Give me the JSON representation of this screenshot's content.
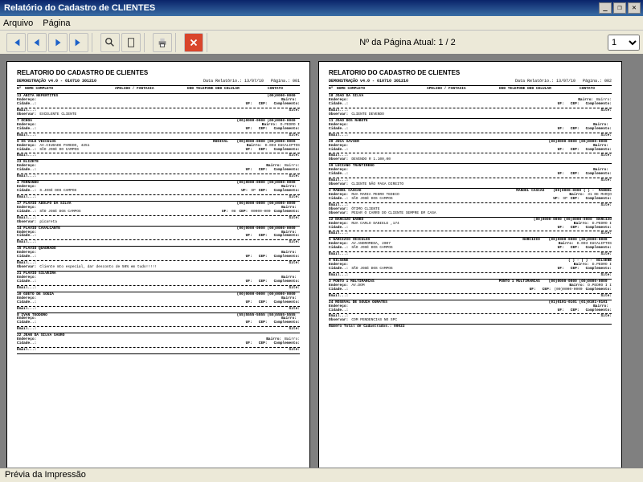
{
  "window": {
    "title": "Relatório do Cadastro de CLIENTES"
  },
  "menu": {
    "file": "Arquivo",
    "page": "Página"
  },
  "toolbar": {
    "page_label": "Nº da Página Atual: 1 / 2",
    "page_select": "1"
  },
  "statusbar": "Prévia da Impressão",
  "report": {
    "title": "RELATORIO DO CADASTRO DE CLIENTES",
    "company": "DEMONSTRAÇÃO v4.0 - 010710 301210",
    "date_label": "Data Relatório.:",
    "date": "13/07/10",
    "page_label": "Página.:",
    "colhead": {
      "num": "Nº",
      "name": "NOME COMPLETO",
      "fantasy": "APELIDO / FANTASIA",
      "phone": "DDD TELEFONE DDD CELULAR",
      "contact": "CONTATO"
    },
    "labels": {
      "endereco": "Endereço:",
      "bairro": "Bairro:",
      "cidade": "Cidade..:",
      "uf": "UF:",
      "cep": "CEP:",
      "complemento": "Complemento:",
      "email": "Email...:",
      "site": "Site:",
      "observar": "Observar:",
      "total": "Número Total de Cadastrados.:"
    },
    "pages": [
      {
        "page_no": "001",
        "records": [
          {
            "id": "13",
            "name": "ANITA NEFERTITES",
            "phone": "(00)0000-0000",
            "obs": "EXCELENTE CLIENTE"
          },
          {
            "id": "7",
            "name": "OCHOA",
            "phone": "(00)0000-0000 (00)0000-0000",
            "bairro": "D.PEDRO I"
          },
          {
            "id": "6",
            "name": "OS VALE VEICULOS",
            "fantasy": "RUDIVAL",
            "phone": "(00)0000-0000 (00)0000-0000",
            "endereco": "AV.CIUDADE PAREDO, 4251",
            "bairro": "D.003 EUCALIPTOS",
            "cidade": "SÃO JOSÉ DO CAMPOS"
          },
          {
            "id": "23",
            "name": "ELIZETE",
            "bairro": "Bairro:"
          },
          {
            "id": "4",
            "name": "FERNANDO",
            "phone": "(00)0000-0000 (00)0000-0000",
            "cidade": "S.JOSÉ DOS CAMPOS",
            "uf": "SP"
          },
          {
            "id": "17",
            "name": "FLAVIO ADOLFO DA SILVA",
            "phone": "(00)0000-0000 (00)0000-0000",
            "cidade": "SÃO JOSÉ DOS CAMPOS",
            "uf": "08",
            "cep": "00000-000",
            "obs": "picareta"
          },
          {
            "id": "14",
            "name": "FLAVIO CAVALCANTE",
            "phone": "(00)0000-0000 (00)0000-0000"
          },
          {
            "id": "15",
            "name": "FLAVIO QUADRADO",
            "obs": "Cliente mto especial, dar desconto de 50% em tudo!!!!!"
          },
          {
            "id": "21",
            "name": "FLAVIO SILVEIRA"
          },
          {
            "id": "10",
            "name": "GUETO DE SOUZA",
            "phone": "(00)0000-0000 (00)0000-0000"
          },
          {
            "id": "8",
            "name": "IVAN TEODORO",
            "phone": "(55)5555-5555 (55)5555-5555"
          },
          {
            "id": "22",
            "name": "JEAN DA SILVA SAURO",
            "bairro": "Bairro:"
          }
        ]
      },
      {
        "page_no": "002",
        "records": [
          {
            "id": "18",
            "name": "JOÃO DA SILVA",
            "bairro": "Bairro:",
            "obs": "CLIENTE DEVENDO"
          },
          {
            "id": "11",
            "name": "JOÃO DOS RABOTE"
          },
          {
            "id": "20",
            "name": "JUCA XAVIER",
            "phone": "(00)0000-0000 (00)0000-0000",
            "obs": "DEVENDO R 1.100,00"
          },
          {
            "id": "19",
            "name": "LUCIANO TRANTIRENO",
            "obs": "CLIENTE NÃO PAGA DIREITO"
          },
          {
            "id": "2",
            "name": "MANOEL CASCÃO",
            "fantasy": "MANOEL CASCÃO",
            "phone": "(00)0000-0000 ( )    -",
            "contact": "MANOEL",
            "endereco": "RUA MARIA PEDRO TEDECO",
            "bairro": "31 DE MARÇO",
            "cidade": "SÃO JOSÉ DOS CAMPOS",
            "uf": "SP",
            "obs": "ÓTIMO CLIENTE",
            "obs2": "PEGAR O CARRO DO CLIENTE SEMPRE EM CASA"
          },
          {
            "id": "12",
            "name": "NARCIZO DANKO",
            "phone": "(00)0000-0000 (00)0000-0000",
            "contact": "NARCIZO",
            "endereco": "RUA CARLO DANIELE ,174",
            "bairro": "D.PEDRO I"
          },
          {
            "id": "5",
            "name": "NARCIZIO VEICULOS",
            "fantasy": "NARCIZIO",
            "phone": "(00)0000-0000 (00)0000-0000",
            "endereco": "AV.ANDROMEDA, 2007",
            "bairro": "D.003 EUCALIPTOS",
            "cidade": "SÃO JOSÉ DOS CAMPOS"
          },
          {
            "id": "9",
            "name": "NILSENE",
            "phone": "( )    -    ( )    -",
            "contact": "NILSENE",
            "cidade": "SÃO JOSÉ DOS CAMPOS",
            "bairro": "D.PEDRO I"
          },
          {
            "id": "3",
            "name": "PONTO 1 MULTIMARCAS",
            "fantasy": "PONTO 1 MULTIMARCAS",
            "phone": "(00)0000-0000 (00)0000-0000",
            "endereco": "AV.DOM",
            "cep": "(00)0000-0000",
            "bairro": "D.PEDRO I I"
          },
          {
            "id": "24",
            "name": "ROSEVAL DE SOUZA OURATES",
            "phone": "(01)0101-0101 (01)0101-0101",
            "obs": "COM PENDENCIAS NO SPC"
          }
        ],
        "total": "00022"
      }
    ]
  }
}
